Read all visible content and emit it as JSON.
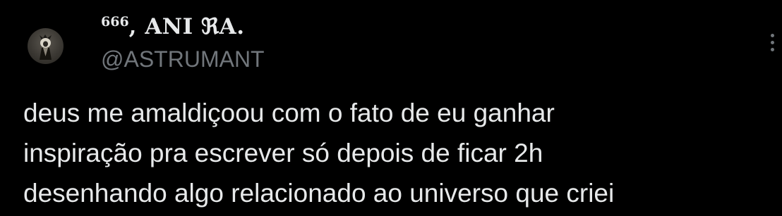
{
  "tweet": {
    "author": {
      "name_prefix": "666",
      "name_main": ", ANI ℜA.",
      "handle": "@ASTRUMANT",
      "avatar_icon": "avatar-hooded-figure-icon"
    },
    "more_icon": "more-vertical-icon",
    "text": "deus me amaldiçoou com o fato de eu ganhar\ninspiração pra escrever só depois de ficar 2h\ndesenhando algo relacionado ao universo que criei"
  },
  "colors": {
    "background": "#000000",
    "primary_text": "#e7e9ea",
    "secondary_text": "#71767b"
  }
}
